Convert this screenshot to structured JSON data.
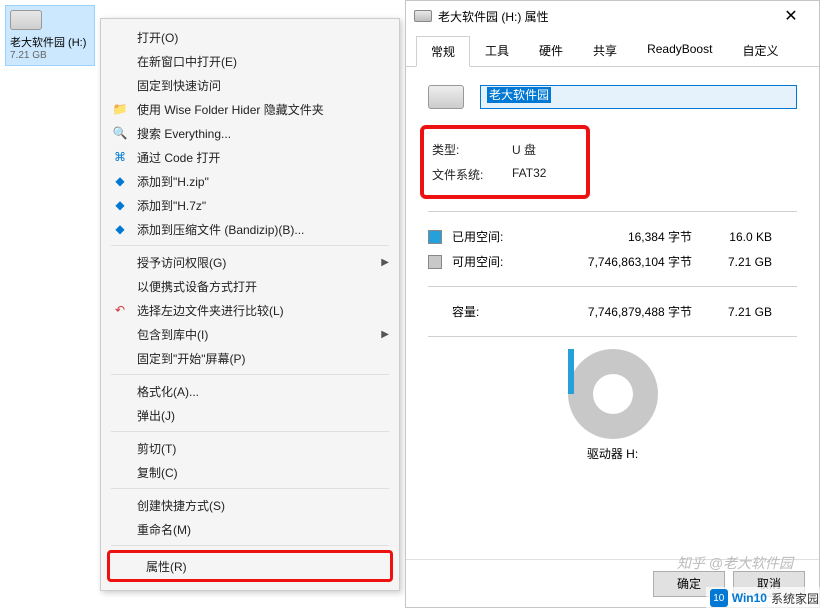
{
  "drive_tile": {
    "label": "老大软件园 (H:)",
    "capacity": "7.21 GB"
  },
  "context_menu": {
    "items": [
      {
        "label": "打开(O)",
        "icon": "",
        "sub": false
      },
      {
        "label": "在新窗口中打开(E)",
        "icon": "",
        "sub": false
      },
      {
        "label": "固定到快速访问",
        "icon": "",
        "sub": false
      },
      {
        "label": "使用 Wise Folder Hider 隐藏文件夹",
        "icon": "📁",
        "icls": "c-blue",
        "sub": false
      },
      {
        "label": "搜索 Everything...",
        "icon": "🔍",
        "icls": "c-orange",
        "sub": false
      },
      {
        "label": "通过 Code 打开",
        "icon": "⌘",
        "icls": "c-az",
        "sub": false
      },
      {
        "label": "添加到\"H.zip\"",
        "icon": "◆",
        "icls": "c-az",
        "sub": false
      },
      {
        "label": "添加到\"H.7z\"",
        "icon": "◆",
        "icls": "c-az",
        "sub": false
      },
      {
        "label": "添加到压缩文件 (Bandizip)(B)...",
        "icon": "◆",
        "icls": "c-az",
        "sub": false
      },
      {
        "sep": true
      },
      {
        "label": "授予访问权限(G)",
        "icon": "",
        "sub": true
      },
      {
        "label": "以便携式设备方式打开",
        "icon": "",
        "sub": false
      },
      {
        "label": "选择左边文件夹进行比较(L)",
        "icon": "↶",
        "icls": "c-red",
        "sub": false
      },
      {
        "label": "包含到库中(I)",
        "icon": "",
        "sub": true
      },
      {
        "label": "固定到\"开始\"屏幕(P)",
        "icon": "",
        "sub": false
      },
      {
        "sep": true
      },
      {
        "label": "格式化(A)...",
        "icon": "",
        "sub": false
      },
      {
        "label": "弹出(J)",
        "icon": "",
        "sub": false
      },
      {
        "sep": true
      },
      {
        "label": "剪切(T)",
        "icon": "",
        "sub": false
      },
      {
        "label": "复制(C)",
        "icon": "",
        "sub": false
      },
      {
        "sep": true
      },
      {
        "label": "创建快捷方式(S)",
        "icon": "",
        "sub": false
      },
      {
        "label": "重命名(M)",
        "icon": "",
        "sub": false
      },
      {
        "sep": true
      }
    ],
    "highlighted": "属性(R)"
  },
  "dialog": {
    "title": "老大软件园 (H:) 属性",
    "close": "✕",
    "tabs": [
      "常规",
      "工具",
      "硬件",
      "共享",
      "ReadyBoost",
      "自定义"
    ],
    "active_tab": 0,
    "name_value": "老大软件园",
    "type": {
      "k": "类型:",
      "v": "U 盘"
    },
    "fs": {
      "k": "文件系统:",
      "v": "FAT32"
    },
    "used": {
      "label": "已用空间:",
      "bytes": "16,384 字节",
      "human": "16.0 KB"
    },
    "free": {
      "label": "可用空间:",
      "bytes": "7,746,863,104 字节",
      "human": "7.21 GB"
    },
    "total": {
      "label": "容量:",
      "bytes": "7,746,879,488 字节",
      "human": "7.21 GB"
    },
    "drive_label": "驱动器 H:",
    "buttons": {
      "ok": "确定",
      "cancel": "取消"
    }
  },
  "watermark1": "知乎 @老大软件园",
  "watermark2": {
    "badge": "10",
    "t1": "Win10",
    "t2": "系统家园"
  }
}
